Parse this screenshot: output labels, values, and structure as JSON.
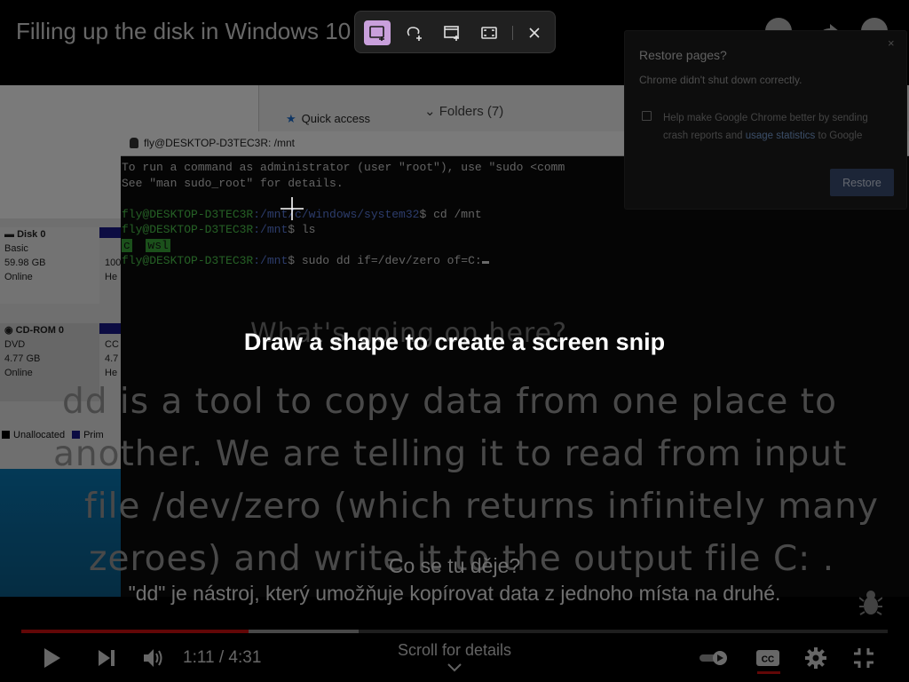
{
  "video": {
    "title": "Filling up the disk in Windows 10",
    "explorer": {
      "quick_access": "Quick access",
      "folders": "Folders (7)"
    },
    "disks": {
      "disk0": {
        "name": "Disk 0",
        "type": "Basic",
        "size": "59.98 GB",
        "status": "Online",
        "partial_size": "100",
        "partial_status": "He"
      },
      "cdrom": {
        "name": "CD-ROM 0",
        "type": "DVD",
        "size": "4.77 GB",
        "status": "Online",
        "partial_size": "4.7",
        "partial_status": "He",
        "partial_label": "CC"
      }
    },
    "legend": {
      "unallocated": "Unallocated",
      "primary": "Prim"
    },
    "terminal": {
      "title": "fly@DESKTOP-D3TEC3R: /mnt",
      "line1": "To run a command as administrator (user \"root\"), use \"sudo <comm",
      "line2": "See \"man sudo_root\" for details.",
      "prompt1_user": "fly@DESKTOP-D3TEC3R",
      "prompt1_path": ":/mnt/c/windows/system32",
      "prompt1_cmd": "$ cd /mnt",
      "prompt2_user": "fly@DESKTOP-D3TEC3R",
      "prompt2_path": ":/mnt",
      "prompt2_cmd": "$ ls",
      "ls_out1": "c",
      "ls_out2": "wsl",
      "prompt3_user": "fly@DESKTOP-D3TEC3R",
      "prompt3_path": ":/mnt",
      "prompt3_cmd": "$ sudo dd if=/dev/zero of=C:"
    },
    "captions": {
      "heading": "What's going on here?",
      "line1": "dd is a tool to copy data from one place to",
      "line2": "another. We are telling it to read from input",
      "line3": "file /dev/zero (which returns infinitely many",
      "line4": "zeroes) and write it to the output file C: ."
    }
  },
  "subtitles": {
    "line1": "Co se tu děje?",
    "line2": "\"dd\" je nástroj, který umožňuje kopírovat data z jednoho místa na druhé."
  },
  "player": {
    "time": "1:11 / 4:31",
    "played_fraction": 0.262,
    "buffered_fraction": 0.389,
    "scroll_hint": "Scroll for details",
    "accent_color": "#cc1010"
  },
  "restore_popup": {
    "title": "Restore pages?",
    "message": "Chrome didn't shut down correctly.",
    "help_pre": "Help make Google Chrome better by sending crash reports and ",
    "help_link": "usage statistics",
    "help_post": " to Google",
    "button": "Restore",
    "close": "×",
    "checkbox_checked": false
  },
  "snip_toolbar": {
    "modes": [
      "rectangle-snip-icon",
      "freeform-snip-icon",
      "window-snip-icon",
      "fullscreen-snip-icon"
    ],
    "selected_mode": "rectangle-snip-icon",
    "selected_color": "#c9a0dc",
    "hint": "Draw a shape to create a screen snip"
  }
}
